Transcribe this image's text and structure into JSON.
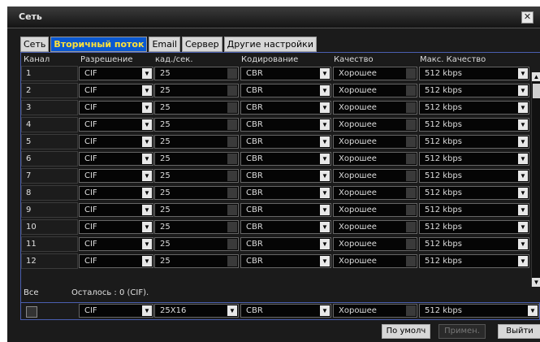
{
  "window": {
    "title": "Сеть",
    "close_icon": "close-icon"
  },
  "tabs": [
    {
      "label": "Сеть"
    },
    {
      "label": "Вторичный поток"
    },
    {
      "label": "Email"
    },
    {
      "label": "Сервер"
    },
    {
      "label": "Другие настройки"
    }
  ],
  "table": {
    "headers": [
      "Канал",
      "Разрешение",
      "кад./сек.",
      "Кодирование",
      "Качество",
      "Макс. Качество"
    ],
    "rows": [
      {
        "channel": "1",
        "resolution": "CIF",
        "fps": "25",
        "encoding": "CBR",
        "quality": "Хорошее",
        "max_quality": "512 kbps"
      },
      {
        "channel": "2",
        "resolution": "CIF",
        "fps": "25",
        "encoding": "CBR",
        "quality": "Хорошее",
        "max_quality": "512 kbps"
      },
      {
        "channel": "3",
        "resolution": "CIF",
        "fps": "25",
        "encoding": "CBR",
        "quality": "Хорошее",
        "max_quality": "512 kbps"
      },
      {
        "channel": "4",
        "resolution": "CIF",
        "fps": "25",
        "encoding": "CBR",
        "quality": "Хорошее",
        "max_quality": "512 kbps"
      },
      {
        "channel": "5",
        "resolution": "CIF",
        "fps": "25",
        "encoding": "CBR",
        "quality": "Хорошее",
        "max_quality": "512 kbps"
      },
      {
        "channel": "6",
        "resolution": "CIF",
        "fps": "25",
        "encoding": "CBR",
        "quality": "Хорошее",
        "max_quality": "512 kbps"
      },
      {
        "channel": "7",
        "resolution": "CIF",
        "fps": "25",
        "encoding": "CBR",
        "quality": "Хорошее",
        "max_quality": "512 kbps"
      },
      {
        "channel": "8",
        "resolution": "CIF",
        "fps": "25",
        "encoding": "CBR",
        "quality": "Хорошее",
        "max_quality": "512 kbps"
      },
      {
        "channel": "9",
        "resolution": "CIF",
        "fps": "25",
        "encoding": "CBR",
        "quality": "Хорошее",
        "max_quality": "512 kbps"
      },
      {
        "channel": "10",
        "resolution": "CIF",
        "fps": "25",
        "encoding": "CBR",
        "quality": "Хорошее",
        "max_quality": "512 kbps"
      },
      {
        "channel": "11",
        "resolution": "CIF",
        "fps": "25",
        "encoding": "CBR",
        "quality": "Хорошее",
        "max_quality": "512 kbps"
      },
      {
        "channel": "12",
        "resolution": "CIF",
        "fps": "25",
        "encoding": "CBR",
        "quality": "Хорошее",
        "max_quality": "512 kbps"
      }
    ]
  },
  "all": {
    "label": "Все",
    "remaining": "Осталось : 0 (CIF).",
    "resolution": "CIF",
    "fps": "25X16",
    "encoding": "CBR",
    "quality": "Хорошее",
    "max_quality": "512 kbps"
  },
  "buttons": {
    "default": "По умолч",
    "apply": "Примен.",
    "exit": "Выйти"
  },
  "colors": {
    "active_tab": "#0a58d0",
    "active_tab_text": "#ffe23a",
    "panel_border": "#4a5fb0"
  }
}
